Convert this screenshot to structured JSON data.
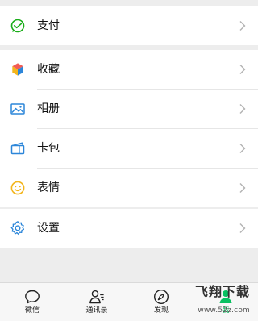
{
  "menu": {
    "pay": {
      "label": "支付",
      "icon": "wechat-pay-icon"
    },
    "favorites": {
      "label": "收藏",
      "icon": "favorites-cube-icon"
    },
    "album": {
      "label": "相册",
      "icon": "photo-album-icon"
    },
    "cards": {
      "label": "卡包",
      "icon": "card-wallet-icon"
    },
    "stickers": {
      "label": "表情",
      "icon": "sticker-smile-icon"
    },
    "settings": {
      "label": "设置",
      "icon": "settings-gear-icon"
    }
  },
  "tabbar": {
    "tabs": [
      {
        "label": "微信",
        "icon": "chat-bubble-icon"
      },
      {
        "label": "通讯录",
        "icon": "contacts-icon"
      },
      {
        "label": "发现",
        "icon": "discover-compass-icon"
      },
      {
        "label": "我",
        "icon": "me-person-icon",
        "active": true
      }
    ]
  },
  "watermark": {
    "title": "飞翔下载",
    "url": "www.52z.com"
  },
  "colors": {
    "background": "#EDEDED",
    "accent": "#07C160",
    "pay_green": "#1AAD19",
    "icon_blue": "#2C86D9",
    "icon_yellow": "#F3B51C"
  }
}
